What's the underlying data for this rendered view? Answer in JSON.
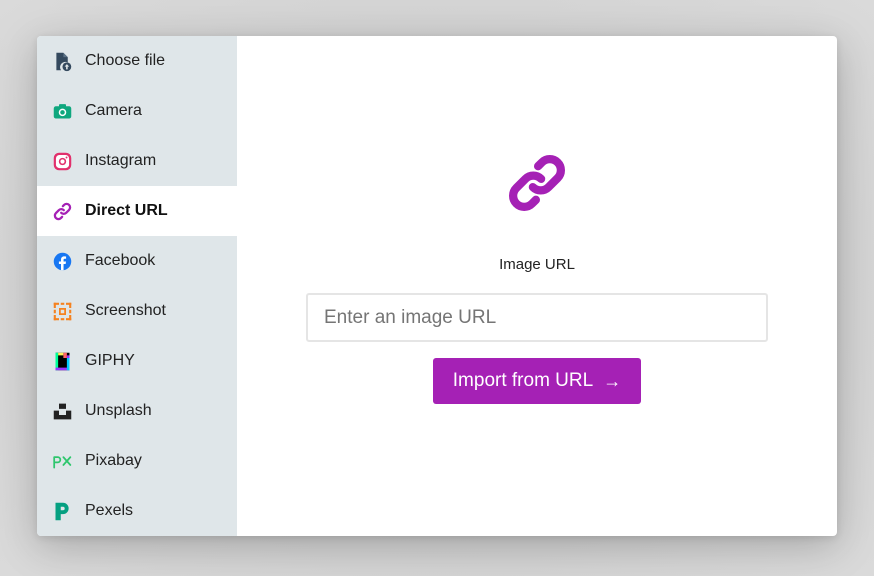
{
  "sidebar": {
    "items": [
      {
        "label": "Choose file",
        "icon": "file-upload-icon"
      },
      {
        "label": "Camera",
        "icon": "camera-icon"
      },
      {
        "label": "Instagram",
        "icon": "instagram-icon"
      },
      {
        "label": "Direct URL",
        "icon": "link-icon",
        "active": true
      },
      {
        "label": "Facebook",
        "icon": "facebook-icon"
      },
      {
        "label": "Screenshot",
        "icon": "screenshot-icon"
      },
      {
        "label": "GIPHY",
        "icon": "giphy-icon"
      },
      {
        "label": "Unsplash",
        "icon": "unsplash-icon"
      },
      {
        "label": "Pixabay",
        "icon": "pixabay-icon"
      },
      {
        "label": "Pexels",
        "icon": "pexels-icon"
      }
    ]
  },
  "main": {
    "icon": "link-icon",
    "url_label": "Image URL",
    "input": {
      "value": "",
      "placeholder": "Enter an image URL"
    },
    "import_button": {
      "label": "Import from URL",
      "arrow": "→"
    }
  },
  "colors": {
    "accent": "#a521b5",
    "sidebar_bg": "#dfe6e9",
    "camera": "#0fa77e",
    "instagram": "#e1306c",
    "facebook": "#1877f2",
    "screenshot": "#f58220",
    "pixabay": "#2ec66d",
    "pexels": "#05a081"
  }
}
